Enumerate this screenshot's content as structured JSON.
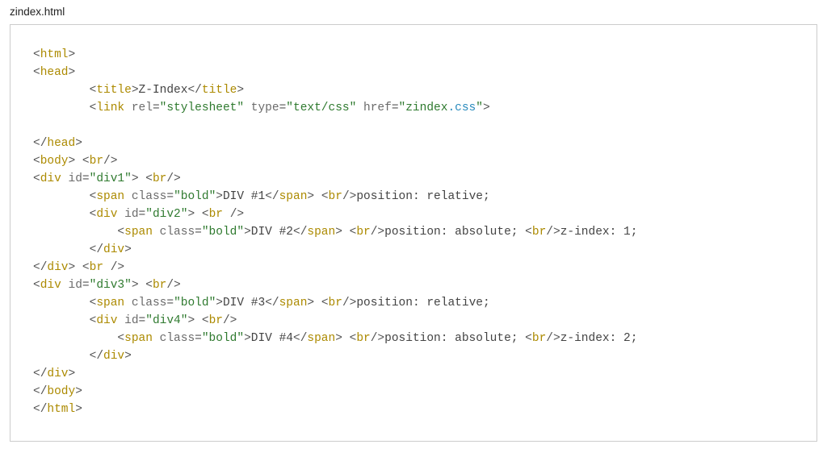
{
  "filename": "zindex.html",
  "code": {
    "title_text": "Z-Index",
    "link_rel": "\"stylesheet\"",
    "link_type": "\"text/css\"",
    "link_href_prefix": "\"zindex",
    "link_href_ext": ".css",
    "link_href_end": "\"",
    "div1_id": "\"div1\"",
    "div2_id": "\"div2\"",
    "div3_id": "\"div3\"",
    "div4_id": "\"div4\"",
    "class_bold": "\"bold\"",
    "span1_text": "DIV #1",
    "span2_text": "DIV #2",
    "span3_text": "DIV #3",
    "span4_text": "DIV #4",
    "pos_rel": "position: relative;",
    "pos_abs": "position: absolute; ",
    "z1": "z-index: 1;",
    "z2": "z-index: 2;",
    "tags": {
      "html": "html",
      "head": "head",
      "title": "title",
      "link": "link",
      "body": "body",
      "br": "br",
      "div": "div",
      "span": "span"
    },
    "attrs": {
      "rel": "rel",
      "type": "type",
      "href": "href",
      "id": "id",
      "class": "class"
    }
  }
}
